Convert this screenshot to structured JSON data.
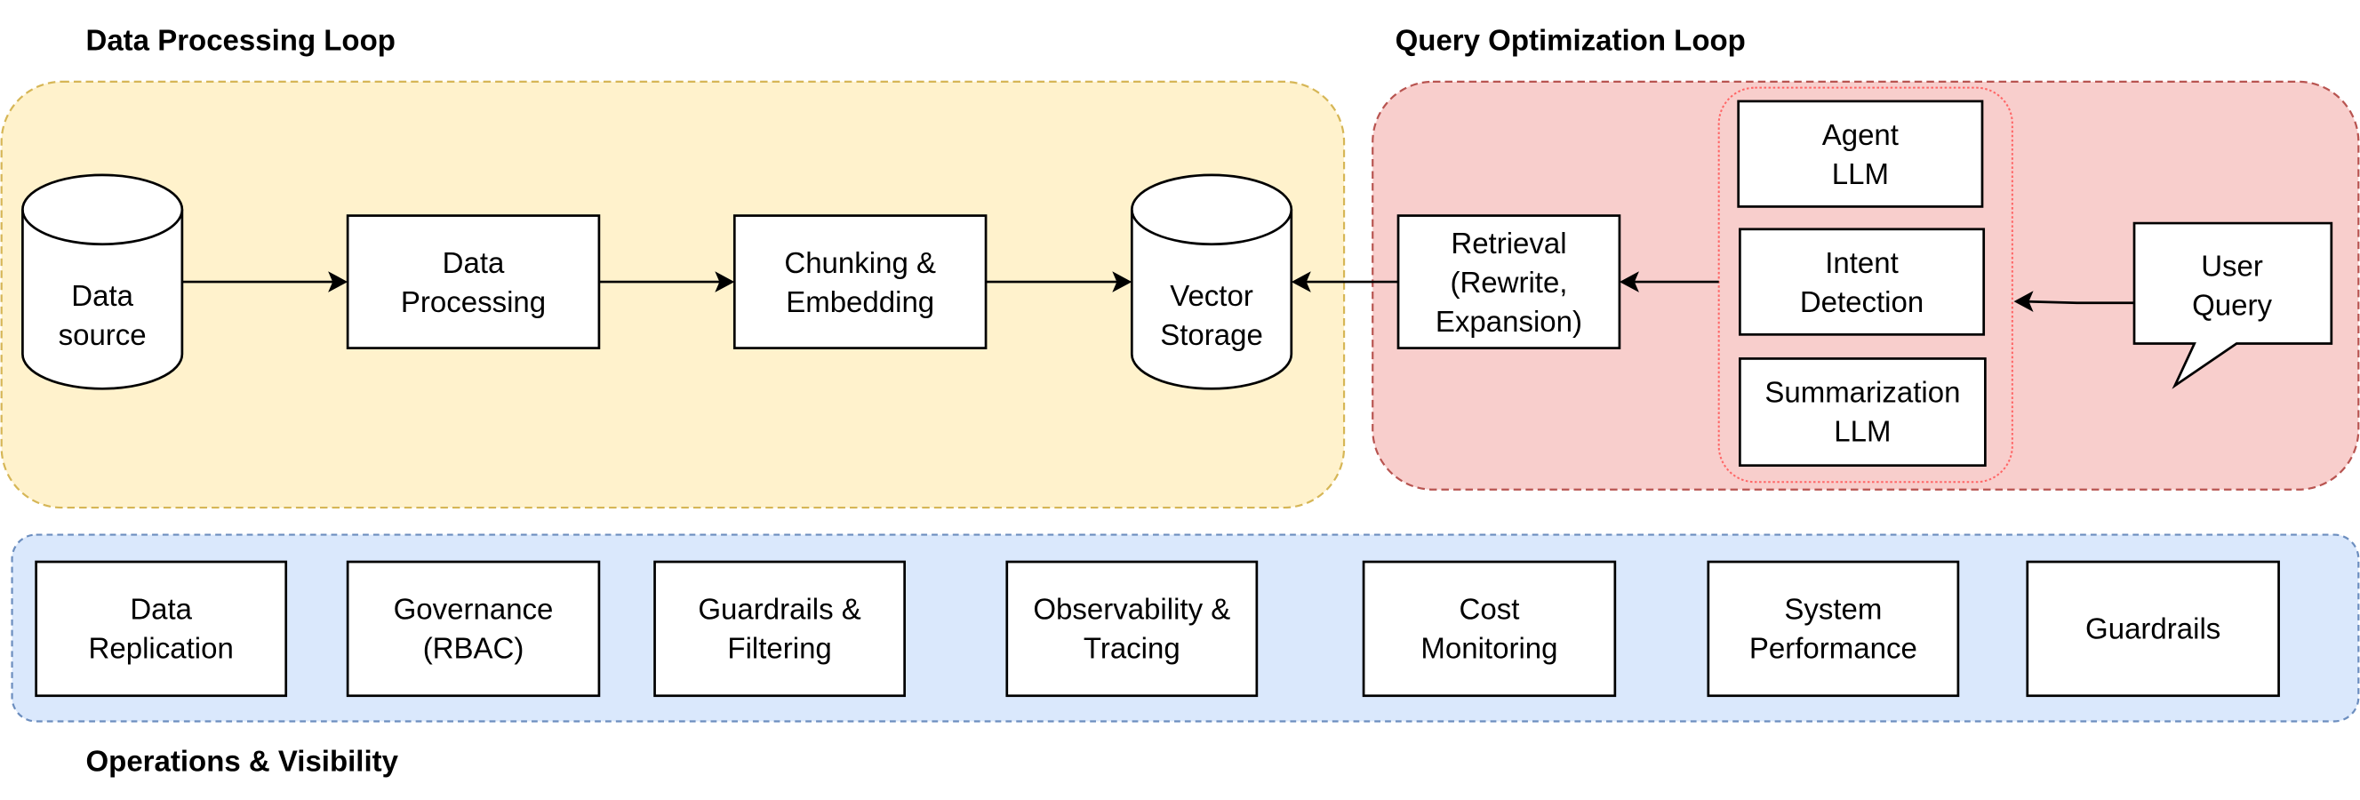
{
  "diagram": {
    "groups": {
      "data_processing": {
        "title": "Data Processing Loop",
        "fill": "#fff2cc",
        "stroke": "#d6b656"
      },
      "query_optimization": {
        "title": "Query Optimization Loop",
        "fill": "#f8cecc",
        "stroke": "#b85450"
      },
      "llm_group": {
        "stroke": "#ff6666"
      },
      "operations": {
        "title": "Operations & Visibility",
        "fill": "#dae8fc",
        "stroke": "#6c8ebf"
      }
    },
    "nodes": {
      "data_source": {
        "line1": "Data",
        "line2": "source",
        "shape": "cylinder"
      },
      "data_processing": {
        "line1": "Data",
        "line2": "Processing"
      },
      "chunking": {
        "line1": "Chunking &",
        "line2": "Embedding"
      },
      "vector_storage": {
        "line1": "Vector",
        "line2": "Storage",
        "shape": "cylinder"
      },
      "retrieval": {
        "line1": "Retrieval",
        "line2": "(Rewrite,",
        "line3": "Expansion)"
      },
      "agent_llm": {
        "line1": "Agent",
        "line2": "LLM"
      },
      "intent_detection": {
        "line1": "Intent",
        "line2": "Detection"
      },
      "summarization_llm": {
        "line1": "Summarization",
        "line2": "LLM"
      },
      "user_query": {
        "line1": "User",
        "line2": "Query",
        "shape": "callout"
      }
    },
    "operations_items": [
      {
        "line1": "Data",
        "line2": "Replication"
      },
      {
        "line1": "Governance",
        "line2": "(RBAC)"
      },
      {
        "line1": "Guardrails &",
        "line2": "Filtering"
      },
      {
        "line1": "Observability &",
        "line2": "Tracing"
      },
      {
        "line1": "Cost",
        "line2": "Monitoring"
      },
      {
        "line1": "System",
        "line2": "Performance"
      },
      {
        "line1": "Guardrails",
        "line2": ""
      }
    ],
    "edges": [
      {
        "from": "Data source",
        "to": "Data Processing"
      },
      {
        "from": "Data Processing",
        "to": "Chunking & Embedding"
      },
      {
        "from": "Chunking & Embedding",
        "to": "Vector Storage"
      },
      {
        "from": "Retrieval (Rewrite, Expansion)",
        "to": "Vector Storage"
      },
      {
        "from": "LLM group",
        "to": "Retrieval (Rewrite, Expansion)"
      },
      {
        "from": "User Query",
        "to": "LLM group"
      }
    ]
  }
}
